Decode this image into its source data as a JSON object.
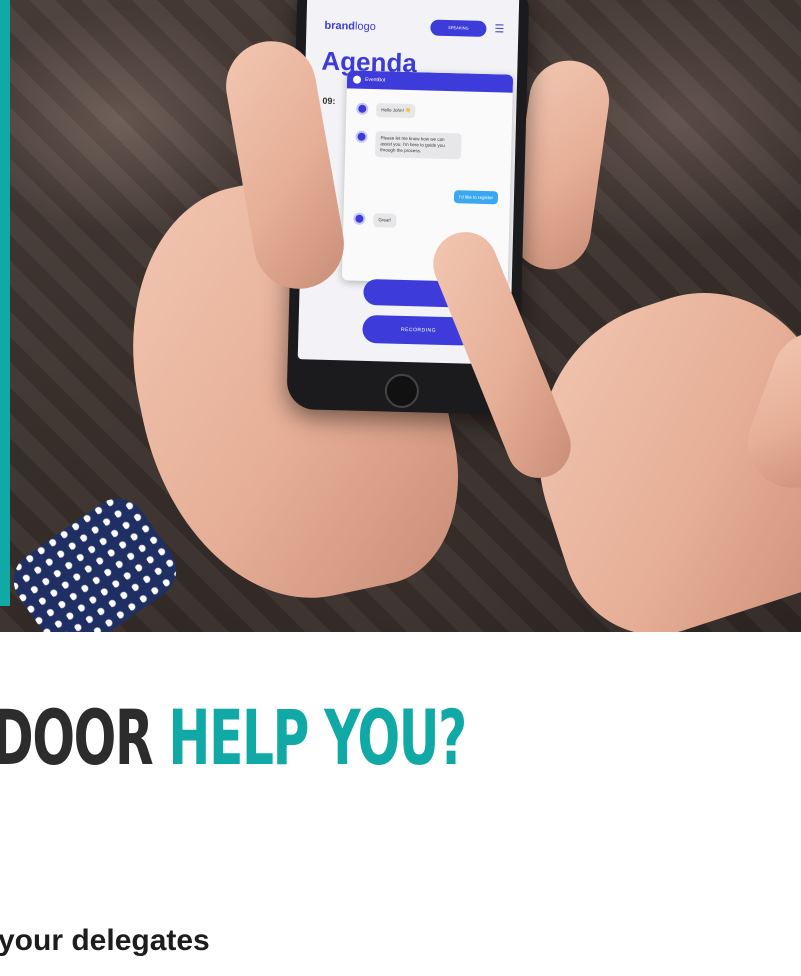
{
  "hero": {
    "phone": {
      "brand_bold": "brand",
      "brand_light": "logo",
      "header_button_label": "SPEAKING",
      "page_title": "Agenda",
      "time_text": "09:",
      "chat": {
        "header_label": "EventBot",
        "messages": [
          {
            "from": "bot",
            "text": "Hello John! 👋"
          },
          {
            "from": "bot",
            "text": "Please let me know how we can assist you. I'm here to guide you through the process."
          },
          {
            "from": "user",
            "text": "I'd like to register"
          },
          {
            "from": "bot",
            "text": "Great!"
          }
        ]
      },
      "recording_label": "RECORDING"
    }
  },
  "heading": {
    "part1": "DOOR ",
    "part2": "HELP YOU?"
  },
  "subheading": "your delegates",
  "colors": {
    "accent_teal": "#10a9a6",
    "brand_blue": "#3d3bd9",
    "heading_dark": "#2c2c2c"
  }
}
